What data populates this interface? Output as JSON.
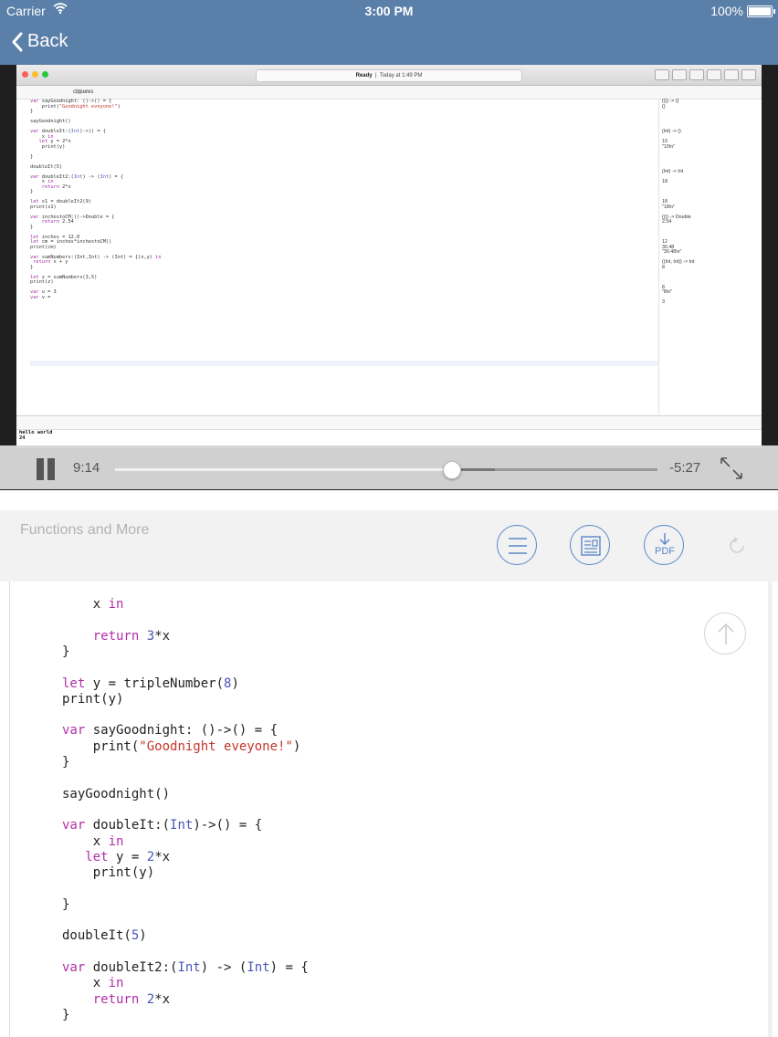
{
  "status_bar": {
    "carrier": "Carrier",
    "time": "3:00 PM",
    "battery": "100%",
    "icons": [
      "wifi-icon",
      "battery-icon"
    ]
  },
  "nav": {
    "back_label": "Back"
  },
  "video": {
    "xcode": {
      "status_ready": "Ready",
      "status_time": "Today at 1:49 PM",
      "file_name": "closures",
      "console_lines": [
        "hello world",
        "24"
      ]
    },
    "controls": {
      "elapsed": "9:14",
      "remaining": "-5:27",
      "progress": 0.62,
      "buffered": 0.7
    }
  },
  "lesson": {
    "title": "Functions and More",
    "pdf_label": "PDF",
    "buttons": [
      "menu-list-icon",
      "document-icon",
      "download-pdf-icon",
      "refresh-icon"
    ]
  },
  "document": {
    "code_lines": [
      [
        [
          "p",
          "    x "
        ],
        [
          "k",
          "in"
        ]
      ],
      [],
      [
        [
          "p",
          "    "
        ],
        [
          "k",
          "return"
        ],
        [
          "p",
          " "
        ],
        [
          "t",
          "3"
        ],
        [
          "p",
          "*x"
        ]
      ],
      [
        [
          "p",
          "}"
        ]
      ],
      [],
      [
        [
          "k",
          "let"
        ],
        [
          "p",
          " y = tripleNumber("
        ],
        [
          "t",
          "8"
        ],
        [
          "p",
          ")"
        ]
      ],
      [
        [
          "p",
          "print(y)"
        ]
      ],
      [],
      [
        [
          "k",
          "var"
        ],
        [
          "p",
          " sayGoodnight: ()->() = {"
        ]
      ],
      [
        [
          "p",
          "    print("
        ],
        [
          "s",
          "\"Goodnight eveyone!\""
        ],
        [
          "p",
          ")"
        ]
      ],
      [
        [
          "p",
          "}"
        ]
      ],
      [],
      [
        [
          "p",
          "sayGoodnight()"
        ]
      ],
      [],
      [
        [
          "k",
          "var"
        ],
        [
          "p",
          " doubleIt:("
        ],
        [
          "t",
          "Int"
        ],
        [
          "p",
          ")->() = {"
        ]
      ],
      [
        [
          "p",
          "    x "
        ],
        [
          "k",
          "in"
        ]
      ],
      [
        [
          "p",
          "   "
        ],
        [
          "k",
          "let"
        ],
        [
          "p",
          " y = "
        ],
        [
          "t",
          "2"
        ],
        [
          "p",
          "*x"
        ]
      ],
      [
        [
          "p",
          "    print(y)"
        ]
      ],
      [],
      [
        [
          "p",
          "}"
        ]
      ],
      [],
      [
        [
          "p",
          "doubleIt("
        ],
        [
          "t",
          "5"
        ],
        [
          "p",
          ")"
        ]
      ],
      [],
      [
        [
          "k",
          "var"
        ],
        [
          "p",
          " doubleIt2:("
        ],
        [
          "t",
          "Int"
        ],
        [
          "p",
          ") -> ("
        ],
        [
          "t",
          "Int"
        ],
        [
          "p",
          ") = {"
        ]
      ],
      [
        [
          "p",
          "    x "
        ],
        [
          "k",
          "in"
        ]
      ],
      [
        [
          "p",
          "    "
        ],
        [
          "k",
          "return"
        ],
        [
          "p",
          " "
        ],
        [
          "t",
          "2"
        ],
        [
          "p",
          "*x"
        ]
      ],
      [
        [
          "p",
          "}"
        ]
      ]
    ]
  }
}
